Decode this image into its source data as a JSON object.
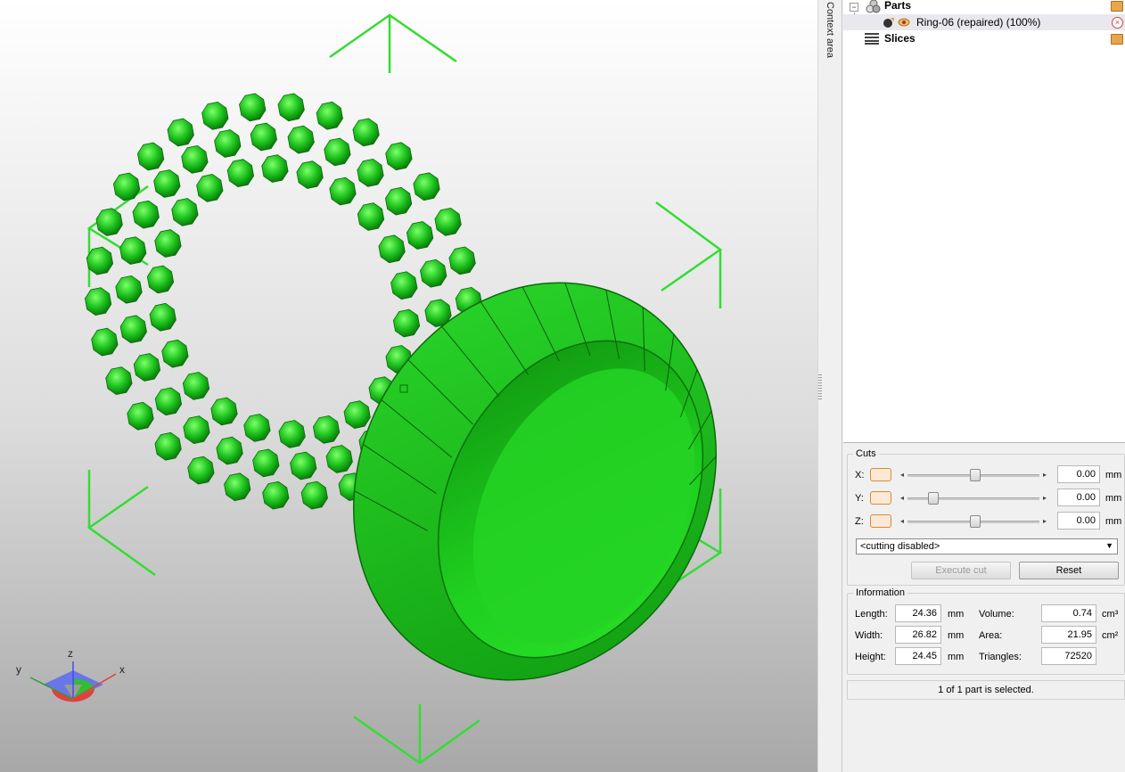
{
  "context_area": {
    "label": "Context area"
  },
  "tree": {
    "parts": {
      "label": "Parts"
    },
    "part_item": {
      "label": "Ring-06 (repaired) (100%)"
    },
    "slices": {
      "label": "Slices"
    }
  },
  "cuts": {
    "title": "Cuts",
    "axes": [
      {
        "label": "X:",
        "value": "0.00",
        "unit": "mm",
        "slider_position": 0.5
      },
      {
        "label": "Y:",
        "value": "0.00",
        "unit": "mm",
        "slider_position": 0.2
      },
      {
        "label": "Z:",
        "value": "0.00",
        "unit": "mm",
        "slider_position": 0.5
      }
    ],
    "mode_select": "<cutting disabled>",
    "execute_label": "Execute cut",
    "reset_label": "Reset"
  },
  "information": {
    "title": "Information",
    "length": {
      "label": "Length:",
      "value": "24.36",
      "unit": "mm"
    },
    "width": {
      "label": "Width:",
      "value": "26.82",
      "unit": "mm"
    },
    "height": {
      "label": "Height:",
      "value": "24.45",
      "unit": "mm"
    },
    "volume": {
      "label": "Volume:",
      "value": "0.74",
      "unit": "cm³"
    },
    "area": {
      "label": "Area:",
      "value": "21.95",
      "unit": "cm²"
    },
    "triangles": {
      "label": "Triangles:",
      "value": "72520"
    }
  },
  "status": {
    "text": "1 of 1 part is selected."
  },
  "axis_widget": {
    "x": "x",
    "y": "y",
    "z": "z"
  },
  "colors": {
    "model": "#22cc22",
    "bbox": "#33dd33",
    "accent": "#d88a3c"
  }
}
